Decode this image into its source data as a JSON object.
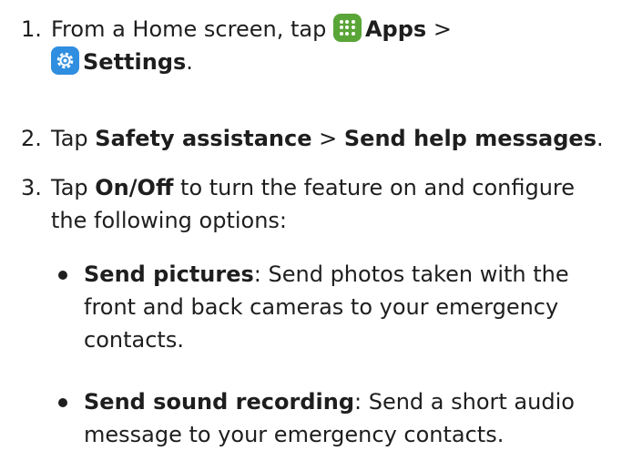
{
  "steps": [
    {
      "number": "1.",
      "lead": "From a Home screen, tap",
      "apps_label": "Apps",
      "separator": ">",
      "settings_label": "Settings",
      "end": "."
    },
    {
      "number": "2.",
      "lead": "Tap",
      "safety_label": "Safety assistance",
      "separator": ">",
      "send_help_label": "Send help messages",
      "end": "."
    },
    {
      "number": "3.",
      "lead": "Tap",
      "onoff_label": "On/Off",
      "rest": "to turn the feature on and configure the following options:"
    }
  ],
  "options": [
    {
      "title": "Send pictures",
      "description": ": Send photos taken with the front and back cameras to your emergency contacts."
    },
    {
      "title": "Send sound recording",
      "description": ": Send a short audio message to your emergency contacts."
    }
  ],
  "icons": {
    "apps": "apps-grid-icon",
    "settings": "gear-icon",
    "apps_color": "#5aa537",
    "settings_color": "#2f8ee0"
  }
}
